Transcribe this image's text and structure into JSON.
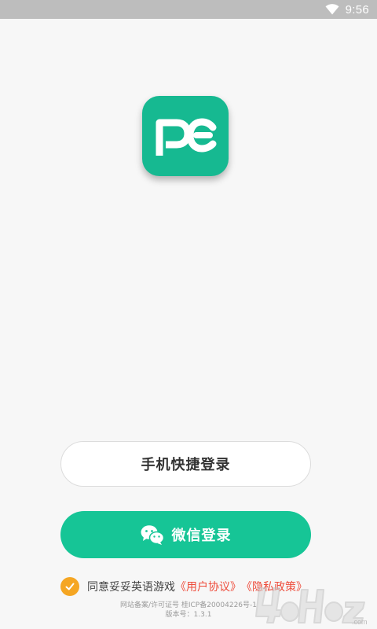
{
  "status_bar": {
    "time": "9:56",
    "icons": [
      "wifi-icon"
    ]
  },
  "app": {
    "logo_text": "PE",
    "logo_color": "#16b991"
  },
  "buttons": {
    "phone_login": "手机快捷登录",
    "wechat_login": "微信登录",
    "wechat_icon": "wechat-icon",
    "wechat_color": "#16c596"
  },
  "agreement": {
    "checked": true,
    "text": "同意妥妥英语游戏",
    "user_agreement": "《用户协议》",
    "privacy_policy": "《隐私政策》",
    "checkbox_color": "#f5a623",
    "link_color": "#ee4b3a"
  },
  "footer": {
    "license": "网站备案/许可证号  桂ICP备20004226号-1",
    "version": "版本号：1.3.1"
  },
  "watermark": {
    "text": "4oHoz.com"
  }
}
